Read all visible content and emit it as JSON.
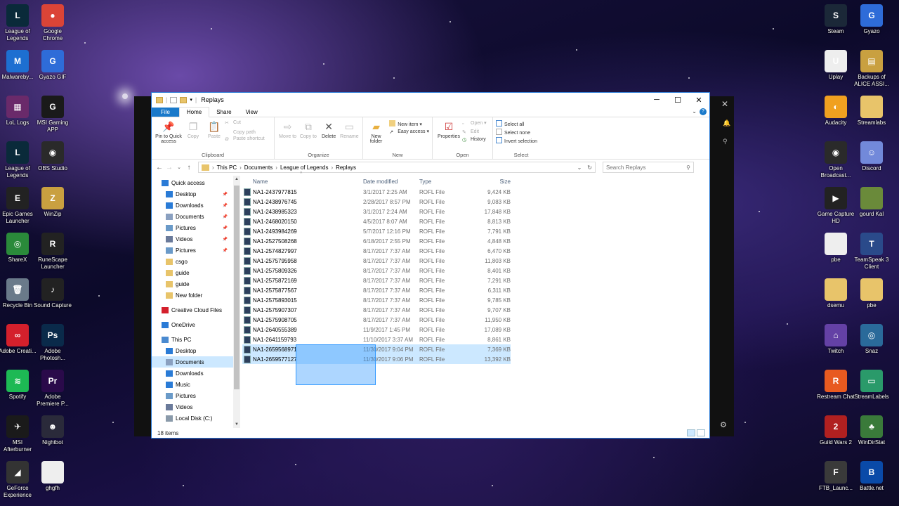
{
  "desktop_left": [
    {
      "label": "League of Legends",
      "icon": "league-of-legends-icon",
      "color": "#0a2a3a",
      "glyph": "L"
    },
    {
      "label": "Google Chrome",
      "icon": "chrome-icon",
      "color": "#db4437",
      "glyph": "●"
    },
    {
      "label": "Malwareby...",
      "icon": "malwarebytes-icon",
      "color": "#1d6fd1",
      "glyph": "M"
    },
    {
      "label": "Gyazo GIF",
      "icon": "gyazo-gif-icon",
      "color": "#2e6cd8",
      "glyph": "G"
    },
    {
      "label": "LoL Logs",
      "icon": "lol-logs-icon",
      "color": "#6a2a6a",
      "glyph": "▦"
    },
    {
      "label": "MSI Gaming APP",
      "icon": "msi-gaming-icon",
      "color": "#1a1a1a",
      "glyph": "G"
    },
    {
      "label": "League of Legends",
      "icon": "league-of-legends-icon",
      "color": "#0a2a3a",
      "glyph": "L"
    },
    {
      "label": "OBS Studio",
      "icon": "obs-studio-icon",
      "color": "#2a2a2a",
      "glyph": "◉"
    },
    {
      "label": "Epic Games Launcher",
      "icon": "epic-games-icon",
      "color": "#222",
      "glyph": "E"
    },
    {
      "label": "WinZip",
      "icon": "winzip-icon",
      "color": "#c9a040",
      "glyph": "Z"
    },
    {
      "label": "ShareX",
      "icon": "sharex-icon",
      "color": "#2a8a3a",
      "glyph": "◎"
    },
    {
      "label": "RuneScape Launcher",
      "icon": "runescape-icon",
      "color": "#222",
      "glyph": "R"
    },
    {
      "label": "Recycle Bin",
      "icon": "recycle-bin-icon",
      "color": "#6a7a8a",
      "glyph": "🗑"
    },
    {
      "label": "Sound Capture",
      "icon": "sound-capture-icon",
      "color": "#222",
      "glyph": "♪"
    },
    {
      "label": "Adobe Creati...",
      "icon": "adobe-cc-icon",
      "color": "#d4202c",
      "glyph": "∞"
    },
    {
      "label": "Adobe Photosh...",
      "icon": "photoshop-icon",
      "color": "#0a2a4a",
      "glyph": "Ps"
    },
    {
      "label": "Spotify",
      "icon": "spotify-icon",
      "color": "#1db954",
      "glyph": "≋"
    },
    {
      "label": "Adobe Premiere P...",
      "icon": "premiere-icon",
      "color": "#2a0a4a",
      "glyph": "Pr"
    },
    {
      "label": "MSI Afterburner",
      "icon": "msi-afterburner-icon",
      "color": "#1a1a1a",
      "glyph": "✈"
    },
    {
      "label": "Nightbot",
      "icon": "nightbot-icon",
      "color": "#2a2a3a",
      "glyph": "☻"
    },
    {
      "label": "GeForce Experience",
      "icon": "geforce-icon",
      "color": "#333",
      "glyph": "◢"
    },
    {
      "label": "ghgfh",
      "icon": "file-icon",
      "color": "#eee",
      "glyph": ""
    }
  ],
  "desktop_right": [
    {
      "label": "Steam",
      "icon": "steam-icon",
      "color": "#1b2838",
      "glyph": "S"
    },
    {
      "label": "Gyazo",
      "icon": "gyazo-icon",
      "color": "#2e6cd8",
      "glyph": "G"
    },
    {
      "label": "Uplay",
      "icon": "uplay-icon",
      "color": "#eee",
      "glyph": "U"
    },
    {
      "label": "Backups of ALICE ASSI...",
      "icon": "archive-icon",
      "color": "#c9a040",
      "glyph": "▤"
    },
    {
      "label": "Audacity",
      "icon": "audacity-icon",
      "color": "#f0a020",
      "glyph": "◐"
    },
    {
      "label": "Streamlabs",
      "icon": "folder-icon",
      "color": "#e8c46a",
      "glyph": ""
    },
    {
      "label": "Open Broadcast...",
      "icon": "obs-icon",
      "color": "#2a2a2a",
      "glyph": "◉"
    },
    {
      "label": "Discord",
      "icon": "discord-icon",
      "color": "#7289da",
      "glyph": "☺"
    },
    {
      "label": "Game Capture HD",
      "icon": "game-capture-icon",
      "color": "#222",
      "glyph": "▶"
    },
    {
      "label": "gourd Kal",
      "icon": "photo-icon",
      "color": "#6a8a3a",
      "glyph": ""
    },
    {
      "label": "pbe",
      "icon": "file-icon",
      "color": "#eee",
      "glyph": ""
    },
    {
      "label": "TeamSpeak 3 Client",
      "icon": "teamspeak-icon",
      "color": "#2a4a8a",
      "glyph": "T"
    },
    {
      "label": "dsemu",
      "icon": "folder-icon",
      "color": "#e8c46a",
      "glyph": ""
    },
    {
      "label": "pbe",
      "icon": "folder-icon",
      "color": "#e8c46a",
      "glyph": ""
    },
    {
      "label": "Twitch",
      "icon": "twitch-icon",
      "color": "#6441a5",
      "glyph": "⌂"
    },
    {
      "label": "Snaz",
      "icon": "snaz-icon",
      "color": "#2a6a9a",
      "glyph": "◎"
    },
    {
      "label": "Restream Chat",
      "icon": "restream-icon",
      "color": "#e85a20",
      "glyph": "R"
    },
    {
      "label": "StreamLabels",
      "icon": "streamlabels-icon",
      "color": "#2a9a6a",
      "glyph": "▭"
    },
    {
      "label": "Guild Wars 2",
      "icon": "guild-wars-icon",
      "color": "#b02020",
      "glyph": "2"
    },
    {
      "label": "WinDirStat",
      "icon": "windirstat-icon",
      "color": "#3a7a3a",
      "glyph": "♣"
    },
    {
      "label": "FTB_Launc...",
      "icon": "ftb-launcher-icon",
      "color": "#3a3a3a",
      "glyph": "F"
    },
    {
      "label": "Battle.net",
      "icon": "battlenet-icon",
      "color": "#0a4aa8",
      "glyph": "B"
    }
  ],
  "window": {
    "title": "Replays",
    "tabs": {
      "file": "File",
      "home": "Home",
      "share": "Share",
      "view": "View"
    },
    "ribbon": {
      "clipboard": {
        "name": "Clipboard",
        "pin": "Pin to Quick access",
        "copy": "Copy",
        "paste": "Paste",
        "cut": "Cut",
        "copy_path": "Copy path",
        "paste_shortcut": "Paste shortcut"
      },
      "organize": {
        "name": "Organize",
        "move_to": "Move to",
        "copy_to": "Copy to",
        "delete": "Delete",
        "rename": "Rename"
      },
      "new": {
        "name": "New",
        "new_folder": "New folder",
        "new_item": "New item",
        "easy_access": "Easy access"
      },
      "open": {
        "name": "Open",
        "properties": "Properties",
        "open": "Open",
        "edit": "Edit",
        "history": "History"
      },
      "select": {
        "name": "Select",
        "select_all": "Select all",
        "select_none": "Select none",
        "invert": "Invert selection"
      }
    },
    "address": {
      "crumbs": [
        "This PC",
        "Documents",
        "League of Legends",
        "Replays"
      ],
      "search_placeholder": "Search Replays"
    },
    "nav": [
      {
        "label": "Quick access",
        "icon": "star-icon",
        "level": 1,
        "gap": false,
        "pin": false
      },
      {
        "label": "Desktop",
        "icon": "desktop-icon",
        "level": 2,
        "pin": true
      },
      {
        "label": "Downloads",
        "icon": "download-icon",
        "level": 2,
        "pin": true
      },
      {
        "label": "Documents",
        "icon": "documents-icon",
        "level": 2,
        "pin": true
      },
      {
        "label": "Pictures",
        "icon": "pictures-icon",
        "level": 2,
        "pin": true
      },
      {
        "label": "Videos",
        "icon": "videos-icon",
        "level": 2,
        "pin": true
      },
      {
        "label": "Pictures",
        "icon": "pictures-icon",
        "level": 2,
        "pin": true
      },
      {
        "label": "csgo",
        "icon": "folder-icon",
        "level": 2,
        "pin": false
      },
      {
        "label": "guide",
        "icon": "folder-icon",
        "level": 2,
        "pin": false
      },
      {
        "label": "guide",
        "icon": "folder-icon",
        "level": 2,
        "pin": false
      },
      {
        "label": "New folder",
        "icon": "folder-icon",
        "level": 2,
        "pin": false
      },
      {
        "label": "Creative Cloud Files",
        "icon": "creative-cloud-icon",
        "level": 1,
        "gap": true,
        "pin": false
      },
      {
        "label": "OneDrive",
        "icon": "onedrive-icon",
        "level": 1,
        "gap": true,
        "pin": false
      },
      {
        "label": "This PC",
        "icon": "this-pc-icon",
        "level": 1,
        "gap": true,
        "pin": false
      },
      {
        "label": "Desktop",
        "icon": "desktop-icon",
        "level": 2,
        "pin": false
      },
      {
        "label": "Documents",
        "icon": "documents-icon",
        "level": 2,
        "pin": false,
        "selected": true
      },
      {
        "label": "Downloads",
        "icon": "download-icon",
        "level": 2,
        "pin": false
      },
      {
        "label": "Music",
        "icon": "music-icon",
        "level": 2,
        "pin": false
      },
      {
        "label": "Pictures",
        "icon": "pictures-icon",
        "level": 2,
        "pin": false
      },
      {
        "label": "Videos",
        "icon": "videos-icon",
        "level": 2,
        "pin": false
      },
      {
        "label": "Local Disk (C:)",
        "icon": "disk-icon",
        "level": 2,
        "pin": false
      }
    ],
    "columns": {
      "name": "Name",
      "date": "Date modified",
      "type": "Type",
      "size": "Size"
    },
    "files": [
      {
        "name": "NA1-2437977815",
        "date": "3/1/2017 2:25 AM",
        "type": "ROFL File",
        "size": "9,424 KB"
      },
      {
        "name": "NA1-2438976745",
        "date": "2/28/2017 8:57 PM",
        "type": "ROFL File",
        "size": "9,083 KB"
      },
      {
        "name": "NA1-2438985323",
        "date": "3/1/2017 2:24 AM",
        "type": "ROFL File",
        "size": "17,848 KB"
      },
      {
        "name": "NA1-2468020150",
        "date": "4/5/2017 8:07 AM",
        "type": "ROFL File",
        "size": "8,813 KB"
      },
      {
        "name": "NA1-2493984269",
        "date": "5/7/2017 12:16 PM",
        "type": "ROFL File",
        "size": "7,791 KB"
      },
      {
        "name": "NA1-2527508268",
        "date": "6/18/2017 2:55 PM",
        "type": "ROFL File",
        "size": "4,848 KB"
      },
      {
        "name": "NA1-2574827997",
        "date": "8/17/2017 7:37 AM",
        "type": "ROFL File",
        "size": "6,470 KB"
      },
      {
        "name": "NA1-2575795958",
        "date": "8/17/2017 7:37 AM",
        "type": "ROFL File",
        "size": "11,803 KB"
      },
      {
        "name": "NA1-2575809326",
        "date": "8/17/2017 7:37 AM",
        "type": "ROFL File",
        "size": "8,401 KB"
      },
      {
        "name": "NA1-2575872169",
        "date": "8/17/2017 7:37 AM",
        "type": "ROFL File",
        "size": "7,291 KB"
      },
      {
        "name": "NA1-2575877567",
        "date": "8/17/2017 7:37 AM",
        "type": "ROFL File",
        "size": "6,311 KB"
      },
      {
        "name": "NA1-2575893015",
        "date": "8/17/2017 7:37 AM",
        "type": "ROFL File",
        "size": "9,785 KB"
      },
      {
        "name": "NA1-2575907307",
        "date": "8/17/2017 7:37 AM",
        "type": "ROFL File",
        "size": "9,707 KB"
      },
      {
        "name": "NA1-2575908705",
        "date": "8/17/2017 7:37 AM",
        "type": "ROFL File",
        "size": "11,950 KB"
      },
      {
        "name": "NA1-2640555389",
        "date": "11/9/2017 1:45 PM",
        "type": "ROFL File",
        "size": "17,089 KB"
      },
      {
        "name": "NA1-2641159793",
        "date": "11/10/2017 3:37 AM",
        "type": "ROFL File",
        "size": "8,861 KB"
      },
      {
        "name": "NA1-2659568971",
        "date": "11/30/2017 9:04 PM",
        "type": "ROFL File",
        "size": "7,369 KB",
        "selected": true
      },
      {
        "name": "NA1-2659577127",
        "date": "11/30/2017 9:06 PM",
        "type": "ROFL File",
        "size": "13,392 KB",
        "selected": true
      }
    ],
    "status": "18 items"
  }
}
